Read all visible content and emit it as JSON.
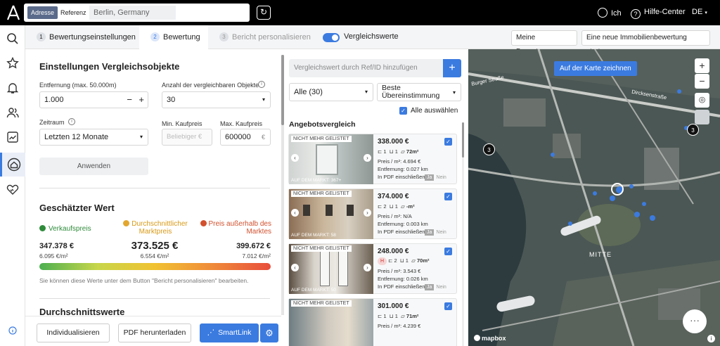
{
  "topbar": {
    "addr_tab": "Adresse",
    "ref_tab": "Referenz",
    "address_value": "Berlin, Germany",
    "me": "Ich",
    "help": "Hilfe-Center",
    "lang": "DE"
  },
  "tabs": {
    "t1_num": "1",
    "t1": "Bewertungseinstellungen",
    "t2_num": "2",
    "t2": "Bewertung",
    "t3_num": "3",
    "t3": "Bericht personalisieren",
    "compare_toggle": "Vergleichswerte",
    "my_valuations": "Meine Bewertungen",
    "new_valuation": "Eine neue Immobilienbewertung starten"
  },
  "settings": {
    "title": "Einstellungen Vergleichsobjekte",
    "distance_label": "Entfernung (max. 50.000m)",
    "distance_value": "1.000",
    "count_label": "Anzahl der vergleichbaren Objekte",
    "count_value": "30",
    "period_label": "Zeitraum",
    "period_value": "Letzten 12 Monate",
    "min_label": "Min. Kaufpreis",
    "min_placeholder": "Beliebiger €",
    "max_label": "Max. Kaufpreis",
    "max_value": "600000",
    "max_unit": "€",
    "apply": "Anwenden"
  },
  "estimate": {
    "title": "Geschätzter Wert",
    "sale_label": "Verkaufspreis",
    "avg_label": "Durchschnittlicher Marktpreis",
    "out_label": "Preis außerhalb des Marktes",
    "low_value": "347.378 €",
    "low_sqm": "6.095 €/m²",
    "mid_value": "373.525 €",
    "mid_sqm": "6.554 €/m²",
    "high_value": "399.672 €",
    "high_sqm": "7.012 €/m²",
    "note": "Sie können diese Werte unter dem Button \"Bericht personalisieren\" bearbeiten.",
    "avg_title": "Durchschnittswerte"
  },
  "bottom": {
    "customize": "Individualisieren",
    "pdf": "PDF herunterladen",
    "smartlink": "SmartLink"
  },
  "compare": {
    "add_placeholder": "Vergleichswert durch Ref/ID hinzufügen",
    "filter_all": "Alle (30)",
    "sort": "Beste Übereinstimmung",
    "select_all": "Alle auswählen",
    "section": "Angebotsvergleich",
    "listings": [
      {
        "badge": "NICHT MEHR GELISTET",
        "market": "AUF DEM MARKT: 367+",
        "price": "338.000 €",
        "rooms": "1",
        "baths": "1",
        "area": "72m²",
        "sqm": "Preis / m²: 4.694 €",
        "dist": "Entfernung: 0.027 km",
        "pdf": "In PDF einschließen",
        "yes": "Ja",
        "no": "Nein"
      },
      {
        "badge": "NICHT MEHR GELISTET",
        "market": "AUF DEM MARKT: 58",
        "price": "374.000 €",
        "rooms": "2",
        "baths": "1",
        "area": "-m²",
        "sqm": "Preis / m²: N/A",
        "dist": "Entfernung: 0.003 km",
        "pdf": "In PDF einschließen",
        "yes": "Ja",
        "no": "Nein"
      },
      {
        "badge": "NICHT MEHR GELISTET",
        "market": "AUF DEM MARKT: 50",
        "price": "248.000 €",
        "tag": "H",
        "rooms": "2",
        "baths": "1",
        "area": "70m²",
        "sqm": "Preis / m²: 3.543 €",
        "dist": "Entfernung: 0.026 km",
        "pdf": "In PDF einschließen",
        "yes": "Ja",
        "no": "Nein"
      },
      {
        "badge": "NICHT MEHR GELISTET",
        "market": "",
        "price": "301.000 €",
        "rooms": "1",
        "baths": "1",
        "area": "71m²",
        "sqm": "Preis / m²: 4.239 €",
        "dist": "",
        "pdf": "",
        "yes": "",
        "no": ""
      }
    ]
  },
  "map": {
    "draw": "Auf der Karte zeichnen",
    "zoom_in": "+",
    "zoom_out": "−",
    "cluster_a": "3",
    "cluster_b": "3",
    "district": "MITTE",
    "street1": "Burger Straße",
    "street2": "Dircksenstraße",
    "brand": "mapbox"
  }
}
